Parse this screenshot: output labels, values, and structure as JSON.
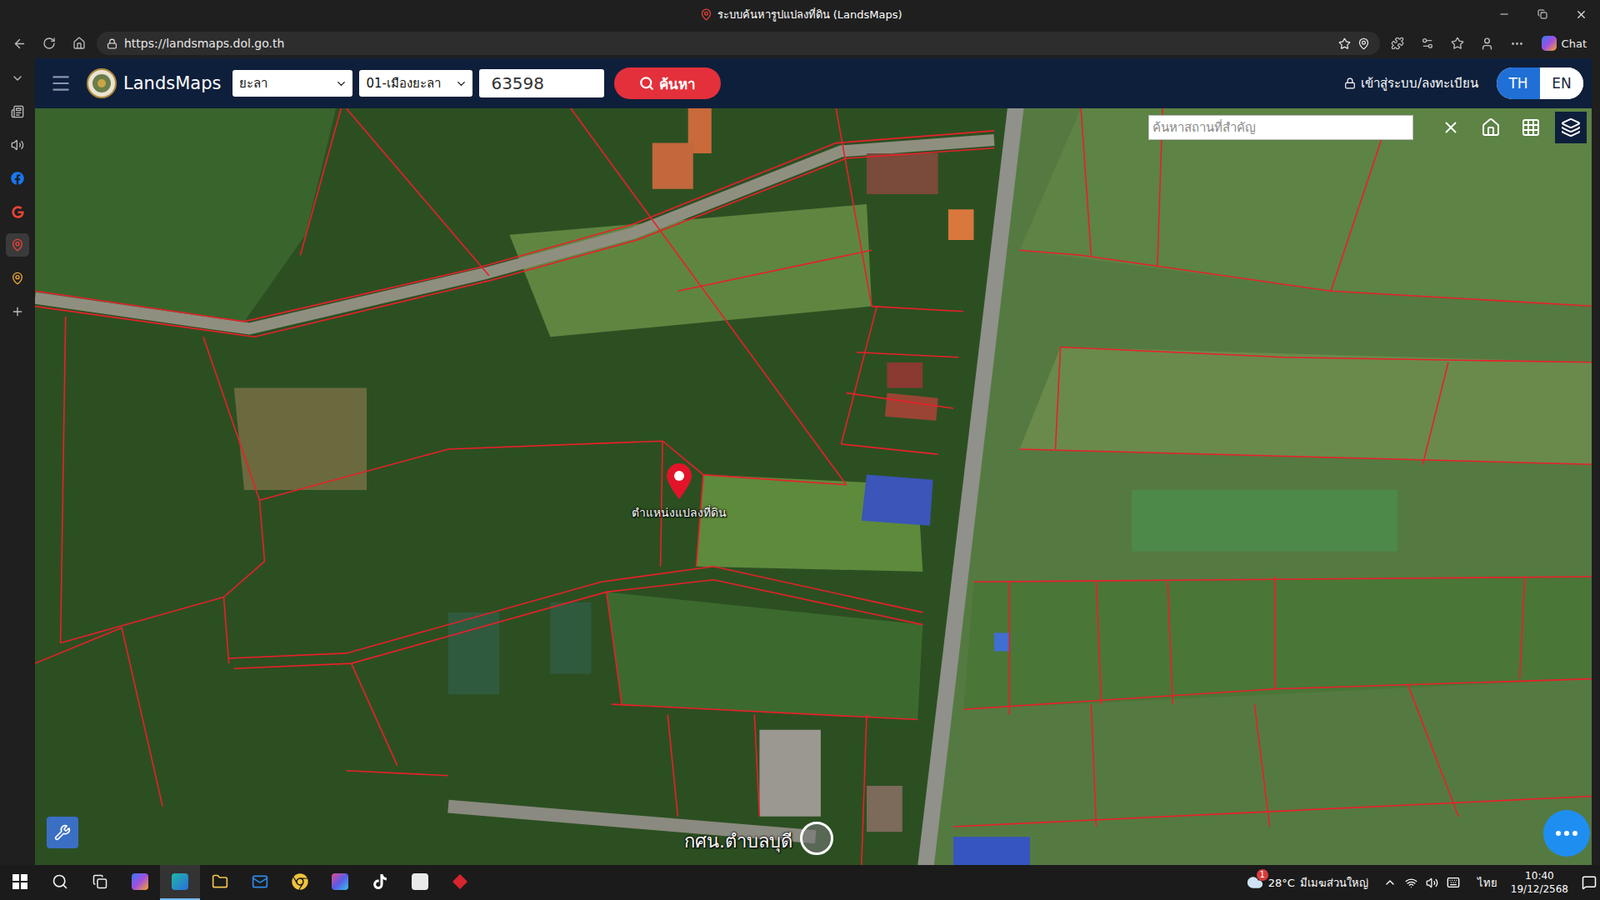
{
  "window": {
    "title": "ระบบค้นหารูปแปลงที่ดิน (LandsMaps)"
  },
  "browser": {
    "url": "https://landsmaps.dol.go.th",
    "chat_button": "Chat"
  },
  "app_header": {
    "brand": "LandsMaps",
    "province": "ยะลา",
    "district": "01-เมืองยะลา",
    "parcel_number": "63598",
    "search_button": "ค้นหา",
    "login": "เข้าสู่ระบบ/ลงทะเบียน",
    "languages": [
      {
        "label": "TH",
        "selected": true
      },
      {
        "label": "EN",
        "selected": false
      }
    ]
  },
  "map": {
    "place_search_placeholder": "ค้นหาสถานที่สำคัญ",
    "pin_label": "ตำแหน่งแปลงที่ดิน",
    "place_label": "กศน.ตำบลบุดี"
  },
  "taskbar": {
    "weather_badge": "1",
    "temperature": "28°C",
    "weather": "มีเมฆส่วนใหญ่",
    "input_language": "ไทย",
    "time": "10:40",
    "date": "19/12/2568"
  }
}
